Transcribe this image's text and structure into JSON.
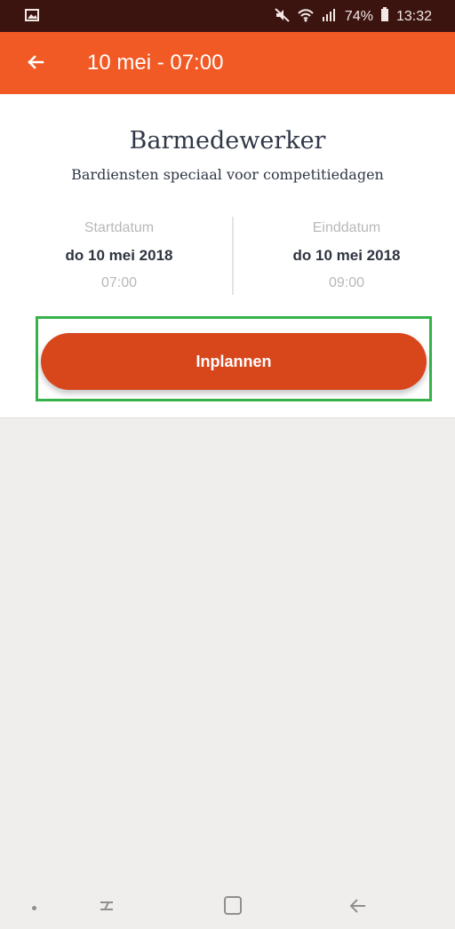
{
  "status_bar": {
    "gallery_icon": "image-icon",
    "mute_icon": "mute-icon",
    "wifi_icon": "wifi-icon",
    "signal_icon": "signal-icon",
    "battery_percent": "74%",
    "battery_icon": "battery-icon",
    "time": "13:32"
  },
  "app_bar": {
    "back_icon": "back-arrow-icon",
    "title": "10 mei - 07:00"
  },
  "shift": {
    "title": "Barmedewerker",
    "subtitle": "Bardiensten speciaal voor competitiedagen",
    "start": {
      "label": "Startdatum",
      "date": "do 10 mei 2018",
      "time": "07:00"
    },
    "end": {
      "label": "Einddatum",
      "date": "do 10 mei 2018",
      "time": "09:00"
    },
    "button_label": "Inplannen"
  },
  "navigation_bar": {
    "dot_icon": "dot-icon",
    "recent_icon": "recent-apps-icon",
    "home_icon": "home-icon",
    "back_icon": "back-icon"
  },
  "colors": {
    "status_bar": "#3b1410",
    "app_bar": "#f15a24",
    "button": "#d8461c",
    "highlight": "#35b34a",
    "background": "#efeeed"
  }
}
